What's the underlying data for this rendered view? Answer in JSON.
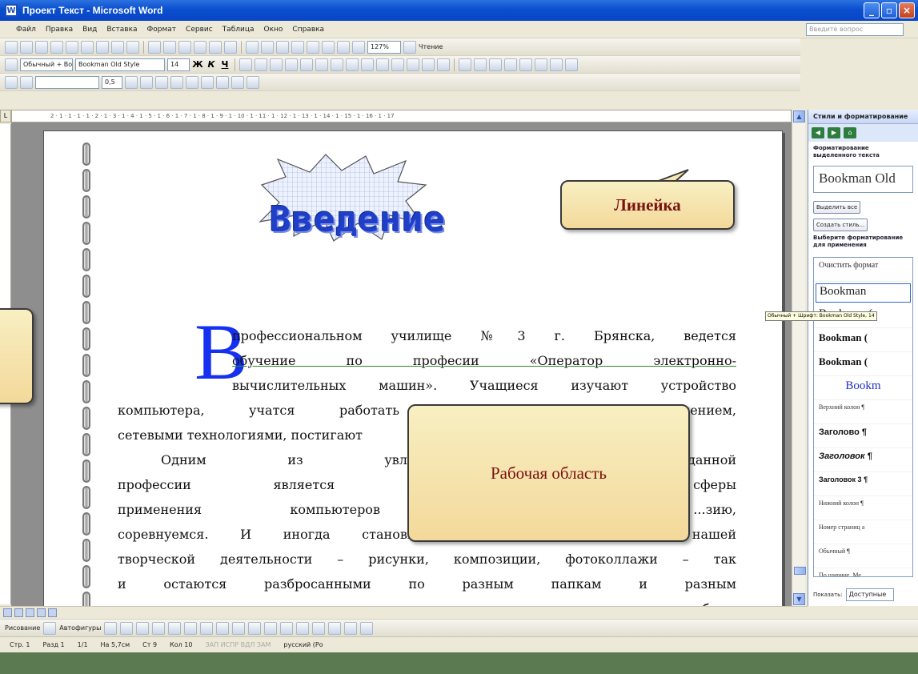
{
  "window": {
    "title": "Проект Текст - Microsoft Word"
  },
  "menu": [
    "Файл",
    "Правка",
    "Вид",
    "Вставка",
    "Формат",
    "Сервис",
    "Таблица",
    "Окно",
    "Справка"
  ],
  "help_box": "Введите вопрос",
  "toolbar": {
    "zoom": "127%",
    "read_label": "Чтение",
    "style": "Обычный + Boo",
    "font": "Bookman Old Style",
    "size": "14",
    "bold": "Ж",
    "italic": "К",
    "underline": "Ч",
    "line_width": "0,5"
  },
  "ruler": {
    "ticks": "2 · 1 · 1 · 1 · 1 · 2 · 1 · 3 · 1 · 4 · 1 · 5 · 1 · 6 · 1 · 7 · 1 · 8 · 1 · 9 · 1 · 10 · 1 · 11 · 1 · 12 · 1 · 13 · 1 · 14 · 1 · 15 · 1 · 16 · 1 · 17"
  },
  "document": {
    "wordart": "Введение",
    "dropcap": "В",
    "p1": [
      "профессиональном училище №3 г. Брянска, ведется",
      "обучение по професии «Оператор электронно-",
      "вычислительных машин». Учащиеся изучают устройство"
    ],
    "p1_rest": [
      "компьютера, учатся работать с программным обеспечением,",
      "сетевыми технологиями, постигают"
    ],
    "p2": [
      "Одним из увлекательнейших ... данной",
      "профессии является компьютерная ... сферы",
      "применения компьютеров мы уч... ...зию,",
      "соревнуемся. И иногда становится жаль, что продукты нашей",
      "творческой деятельности – рисунки, композиции, фотоколлажи – так",
      "и остаются разбросанными по разным папкам и разным",
      "компьютерам, и никто, кроме преподавателя, не оценит нашу работу."
    ]
  },
  "taskpane": {
    "title": "Стили и форматирование",
    "selected_label": "Форматирование выделенного текста",
    "current_font": "Bookman Old",
    "select_all": "Выделить все",
    "new_style": "Создать стиль...",
    "apply_label": "Выберите форматирование для применения",
    "styles": [
      "Очистить формат",
      "Bookman",
      "Bookman (",
      "Bookman (",
      "Bookman (",
      "Bookm",
      "Верхний колон ¶",
      "Заголово ¶",
      "Заголовок ¶",
      "Заголовок 3 ¶",
      "Нижний колон ¶",
      "Номер страниц a",
      "Обычный ¶",
      "По ширине, Ме"
    ],
    "show_label": "Показать:",
    "show_value": "Доступные"
  },
  "tooltip": "Обычный + Шрифт: Bookman Old Style, 14",
  "drawbar": {
    "draw": "Рисование",
    "autoshapes": "Автофигуры"
  },
  "status": {
    "page": "Стр. 1",
    "section": "Разд 1",
    "pages": "1/1",
    "at": "На 5,7см",
    "line": "Ст 9",
    "col": "Кол 10",
    "modes": "ЗАП ИСПР ВДЛ ЗАМ",
    "lang": "русский (Ро"
  },
  "callouts": {
    "ruler": "Линейка",
    "workarea": "Рабочая область"
  },
  "colors": {
    "title_blue": "#0a4fce",
    "callout_fill": "#f3d99a",
    "callout_text": "#7a1010",
    "wordart_blue": "#1f3fc8"
  }
}
